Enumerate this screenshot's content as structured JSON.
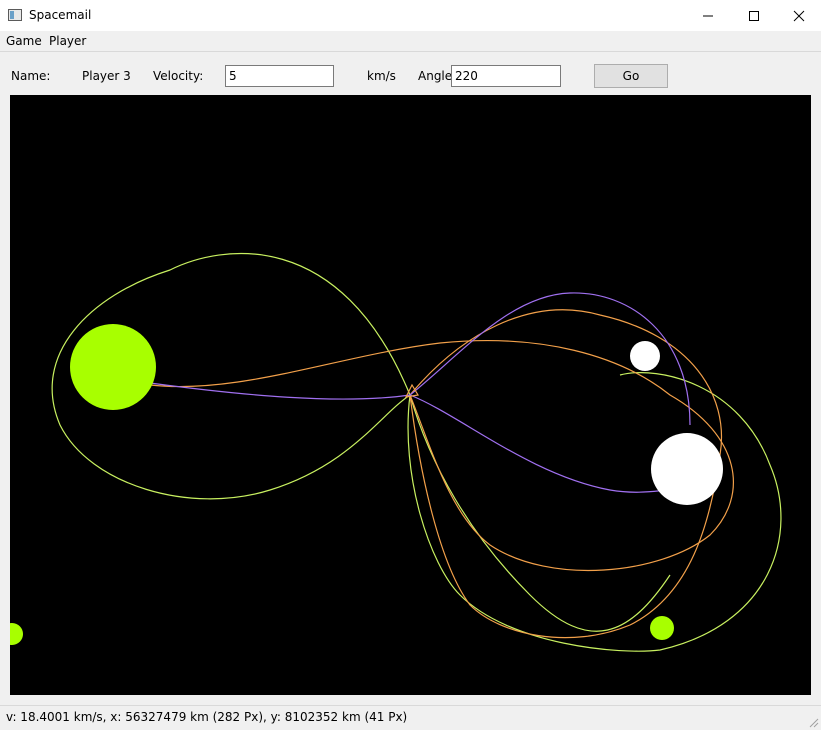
{
  "window": {
    "title": "Spacemail",
    "min_glyph": "—",
    "max_glyph": "☐",
    "close_glyph": "✕"
  },
  "menu": {
    "items": [
      "Game",
      "Player"
    ]
  },
  "toolbar": {
    "name_label": "Name:",
    "player_name": "Player 3",
    "velocity_label": "Velocity:",
    "velocity_value": "5",
    "velocity_unit": "km/s",
    "angle_label": "Angle",
    "angle_value": "220",
    "go_label": "Go"
  },
  "scene": {
    "colors": {
      "background": "#000000",
      "lime": "#a8ff00",
      "white": "#ffffff",
      "green_trail": "#c8f060",
      "orange_trail": "#f2a04a",
      "purple_trail": "#a070f0"
    },
    "bodies": [
      "large-lime-planet",
      "small-lime-planet",
      "edge-lime-planet",
      "large-white-planet",
      "small-white-planet"
    ]
  },
  "status": {
    "text": "v: 18.4001 km/s, x: 56327479 km (282 Px), y: 8102352 km (41 Px)"
  }
}
